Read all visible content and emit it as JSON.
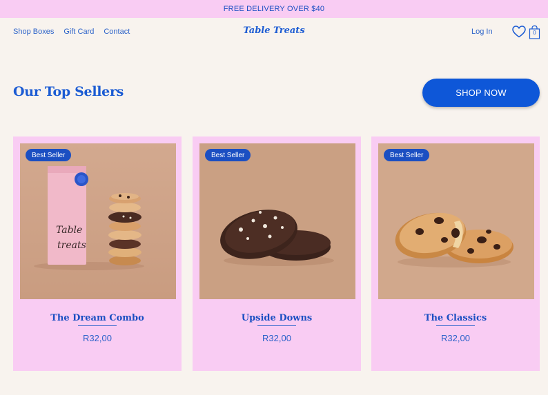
{
  "promo": {
    "text": "FREE DELIVERY OVER $40"
  },
  "header": {
    "nav": [
      "Shop Boxes",
      "Gift Card",
      "Contact"
    ],
    "logo": "Table Treats",
    "login": "Log In",
    "cart_count": "0"
  },
  "section": {
    "title": "Our Top Sellers",
    "cta": "SHOP NOW"
  },
  "products": [
    {
      "badge": "Best Seller",
      "name": "The Dream Combo",
      "price": "R32,00",
      "bag_text_line1": "Table",
      "bag_text_line2": "treats"
    },
    {
      "badge": "Best Seller",
      "name": "Upside Downs",
      "price": "R32,00"
    },
    {
      "badge": "Best Seller",
      "name": "The Classics",
      "price": "R32,00"
    }
  ],
  "colors": {
    "page_bg": "#f8f3ee",
    "accent_pink": "#f9ccf3",
    "brand_blue": "#0e57d8"
  },
  "icons": [
    "heart-icon",
    "shopping-bag-icon"
  ]
}
